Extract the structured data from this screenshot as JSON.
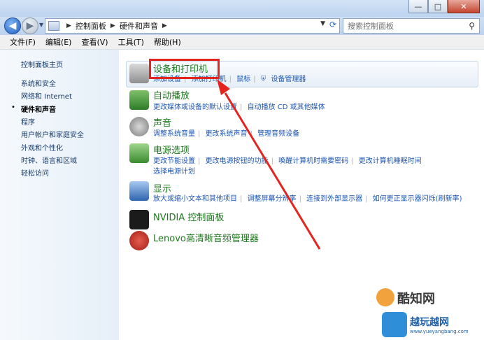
{
  "window": {
    "buttons": [
      "—",
      "□",
      "✕"
    ]
  },
  "address": {
    "crumbs": [
      "控制面板",
      "硬件和声音"
    ],
    "search_placeholder": "搜索控制面板"
  },
  "menu": [
    "文件(F)",
    "编辑(E)",
    "查看(V)",
    "工具(T)",
    "帮助(H)"
  ],
  "sidebar": {
    "items": [
      "控制面板主页",
      "系统和安全",
      "网络和 Internet",
      "硬件和声音",
      "程序",
      "用户帐户和家庭安全",
      "外观和个性化",
      "时钟、语言和区域",
      "轻松访问"
    ],
    "active": "硬件和声音"
  },
  "categories": [
    {
      "title": "设备和打印机",
      "links": [
        "添加设备",
        "添加打印机",
        "鼠标",
        "设备管理器"
      ]
    },
    {
      "title": "自动播放",
      "links": [
        "更改媒体或设备的默认设置",
        "自动播放 CD 或其他媒体"
      ]
    },
    {
      "title": "声音",
      "links": [
        "调整系统音量",
        "更改系统声音",
        "管理音频设备"
      ]
    },
    {
      "title": "电源选项",
      "links": [
        "更改节能设置",
        "更改电源按钮的功能",
        "唤醒计算机时需要密码",
        "更改计算机睡眠时间"
      ],
      "links2": [
        "选择电源计划"
      ]
    },
    {
      "title": "显示",
      "links": [
        "放大或缩小文本和其他项目",
        "调整屏幕分辨率",
        "连接到外部显示器",
        "如何更正显示器闪烁(刷新率)"
      ]
    },
    {
      "title": "NVIDIA 控制面板",
      "links": []
    },
    {
      "title": "Lenovo高清晰音频管理器",
      "links": []
    }
  ],
  "watermarks": {
    "top": "酷知网",
    "bottom": "越玩越网",
    "url": "www.yueyangbang.com"
  },
  "colors": {
    "link": "#1c56b5",
    "title": "#1e7a1e",
    "annotation": "#e3241f"
  }
}
